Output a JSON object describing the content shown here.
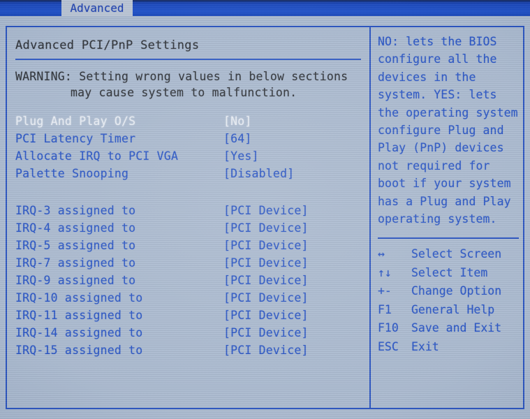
{
  "menubar": {
    "tabs": [
      {
        "label": "Advanced",
        "active": true
      }
    ]
  },
  "left_pane": {
    "title": "Advanced PCI/PnP Settings",
    "warning": {
      "line1": "WARNING: Setting wrong values in below sections",
      "line2": "may cause system to malfunction."
    },
    "options": [
      {
        "label": "Plug And Play O/S",
        "value": "[No]",
        "selected": true
      },
      {
        "label": "PCI Latency Timer",
        "value": "[64]",
        "selected": false
      },
      {
        "label": "Allocate IRQ to PCI VGA",
        "value": "[Yes]",
        "selected": false
      },
      {
        "label": "Palette Snooping",
        "value": "[Disabled]",
        "selected": false
      }
    ],
    "irq_options": [
      {
        "label": "IRQ-3 assigned to",
        "value": "[PCI Device]",
        "selected": false
      },
      {
        "label": "IRQ-4 assigned to",
        "value": "[PCI Device]",
        "selected": false
      },
      {
        "label": "IRQ-5 assigned to",
        "value": "[PCI Device]",
        "selected": false
      },
      {
        "label": "IRQ-7 assigned to",
        "value": "[PCI Device]",
        "selected": false
      },
      {
        "label": "IRQ-9 assigned to",
        "value": "[PCI Device]",
        "selected": false
      },
      {
        "label": "IRQ-10 assigned to",
        "value": "[PCI Device]",
        "selected": false
      },
      {
        "label": "IRQ-11 assigned to",
        "value": "[PCI Device]",
        "selected": false
      },
      {
        "label": "IRQ-14 assigned to",
        "value": "[PCI Device]",
        "selected": false
      },
      {
        "label": "IRQ-15 assigned to",
        "value": "[PCI Device]",
        "selected": false
      }
    ]
  },
  "right_pane": {
    "help_text": "NO: lets the BIOS configure all the devices in the system. YES: lets the operating system configure Plug and Play (PnP) devices not required for boot if your system has a Plug and Play operating system.",
    "keys": [
      {
        "key": "↔",
        "icon": "left-right-arrow-icon",
        "desc": "Select Screen"
      },
      {
        "key": "↑↓",
        "icon": "up-down-arrow-icon",
        "desc": "Select Item"
      },
      {
        "key": "+-",
        "icon": "plus-minus-icon",
        "desc": "Change Option"
      },
      {
        "key": "F1",
        "icon": "f1-key-icon",
        "desc": "General Help"
      },
      {
        "key": "F10",
        "icon": "f10-key-icon",
        "desc": "Save and Exit"
      },
      {
        "key": "ESC",
        "icon": "esc-key-icon",
        "desc": "Exit"
      }
    ]
  },
  "colors": {
    "screen_background": "#a9b9cf",
    "menubar_blue": "#1746bd",
    "tab_active_background": "#b9c4d4",
    "border_blue": "#2550c0",
    "text_blue": "#2552c4",
    "text_dark": "#2c3036",
    "text_selected": "#e9eef6"
  }
}
